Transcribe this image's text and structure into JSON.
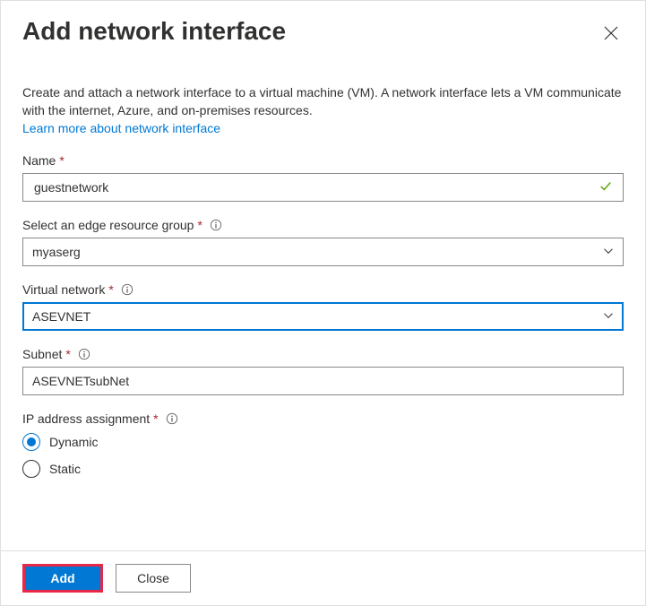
{
  "header": {
    "title": "Add network interface"
  },
  "description": "Create and attach a network interface to a virtual machine (VM). A network interface lets a VM communicate with the internet, Azure, and on-premises resources.",
  "learn_more": "Learn more about network interface",
  "fields": {
    "name": {
      "label": "Name",
      "value": "guestnetwork"
    },
    "resource_group": {
      "label": "Select an edge resource group",
      "value": "myaserg"
    },
    "vnet": {
      "label": "Virtual network",
      "value": "ASEVNET"
    },
    "subnet": {
      "label": "Subnet",
      "value": "ASEVNETsubNet"
    },
    "ip_assignment": {
      "label": "IP address assignment",
      "options": {
        "dynamic": "Dynamic",
        "static": "Static"
      },
      "selected": "dynamic"
    }
  },
  "footer": {
    "add": "Add",
    "close": "Close"
  }
}
